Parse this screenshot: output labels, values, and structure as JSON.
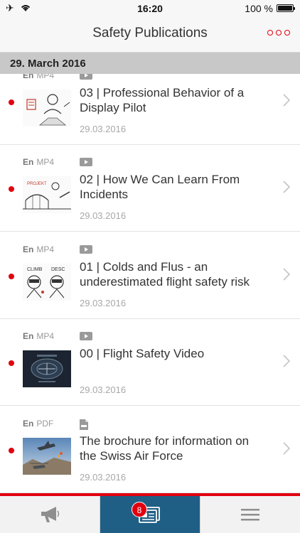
{
  "status": {
    "time": "16:20",
    "battery": "100 %"
  },
  "nav": {
    "title": "Safety Publications"
  },
  "section": {
    "date": "29. March 2016"
  },
  "items": [
    {
      "lang": "En",
      "format": "MP4",
      "kind": "video",
      "title": "03 | Professional Behavior of a Display Pilot",
      "date": "29.03.2016"
    },
    {
      "lang": "En",
      "format": "MP4",
      "kind": "video",
      "title": "02 | How We Can Learn From Incidents",
      "date": "29.03.2016"
    },
    {
      "lang": "En",
      "format": "MP4",
      "kind": "video",
      "title": "01 | Colds and Flus - an underestimated flight safety risk",
      "date": "29.03.2016"
    },
    {
      "lang": "En",
      "format": "MP4",
      "kind": "video",
      "title": "00 | Flight Safety Video",
      "date": "29.03.2016"
    },
    {
      "lang": "En",
      "format": "PDF",
      "kind": "document",
      "title": "The brochure for information on the Swiss Air Force",
      "date": "29.03.2016"
    }
  ],
  "tabbar": {
    "badge": "8"
  },
  "colors": {
    "accent": "#e1000f",
    "active_tab": "#1f5f86"
  }
}
